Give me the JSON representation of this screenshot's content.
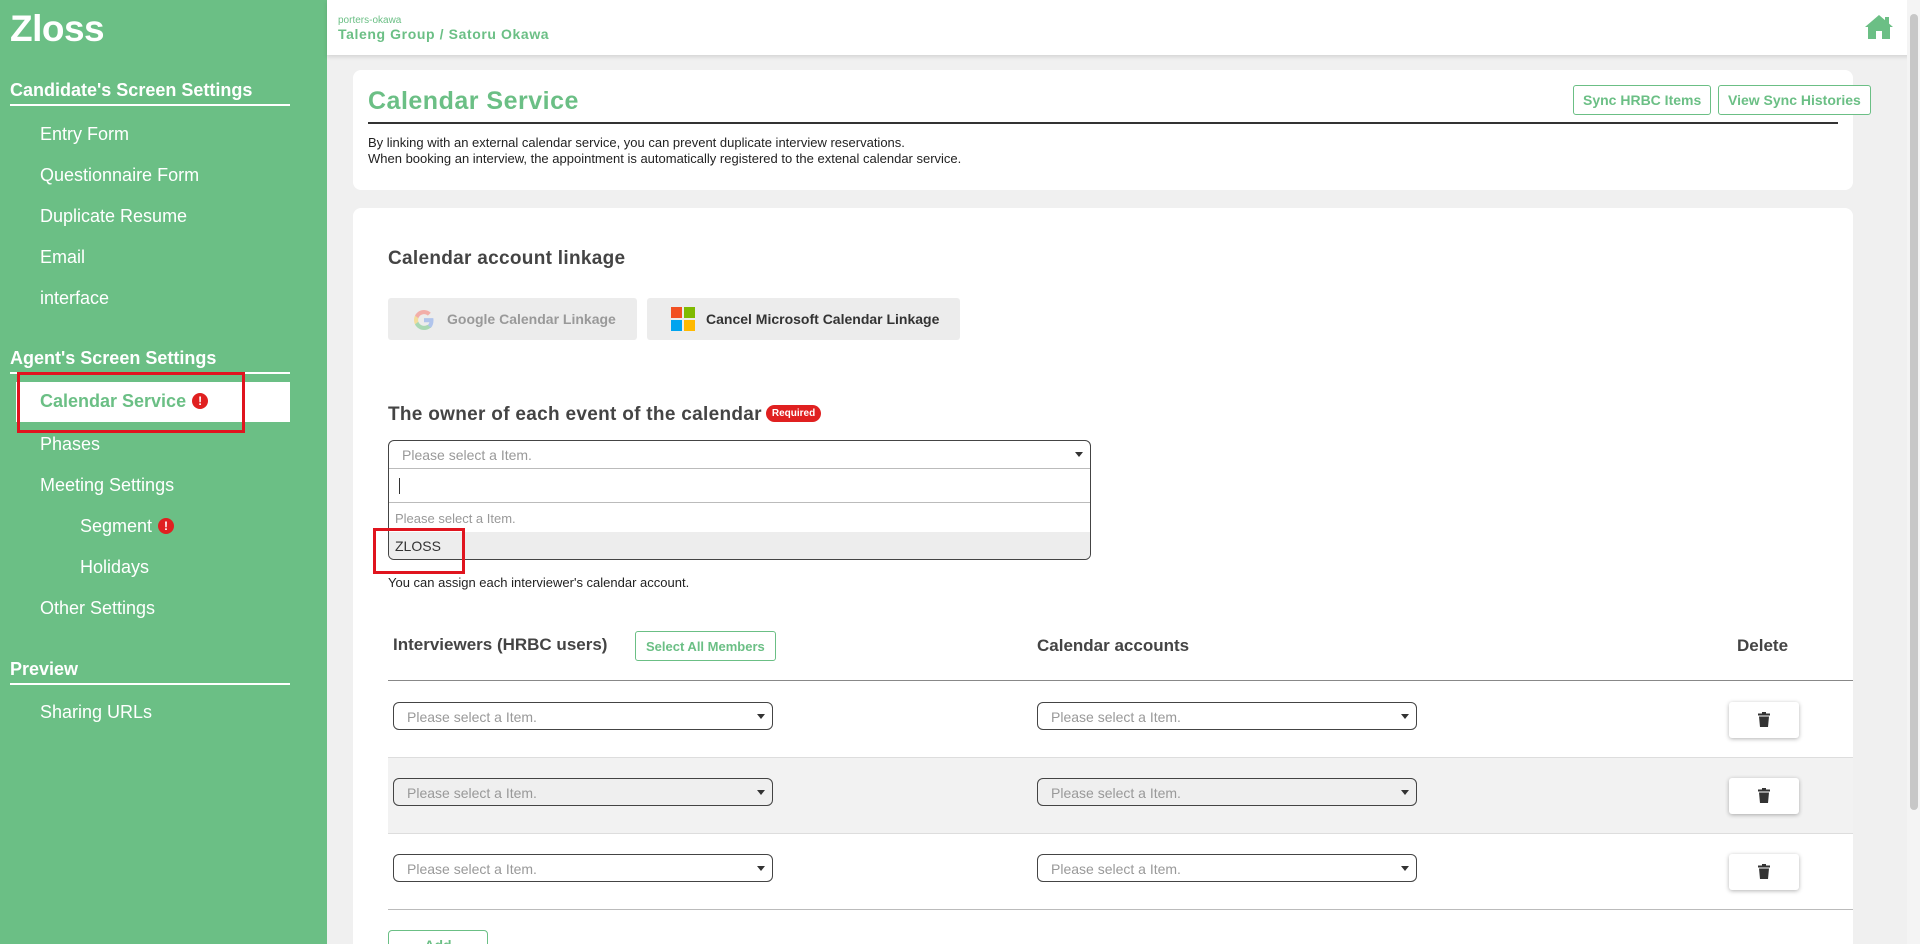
{
  "sidebar": {
    "brand": "Zloss",
    "sections": {
      "candidate": "Candidate's Screen Settings",
      "agent": "Agent's Screen Settings",
      "preview": "Preview"
    },
    "candidate_items": [
      "Entry Form",
      "Questionnaire Form",
      "Duplicate Resume",
      "Email",
      "interface"
    ],
    "agent_items": {
      "calendar_service": "Calendar Service",
      "phases": "Phases",
      "meeting_settings": "Meeting Settings",
      "segment": "Segment",
      "holidays": "Holidays",
      "other_settings": "Other Settings"
    },
    "preview_items": [
      "Sharing URLs"
    ],
    "alert_glyph": "!"
  },
  "header": {
    "tenant": "porters-okawa",
    "org_user": "Taleng Group / Satoru Okawa",
    "home_icon": "home-icon"
  },
  "page": {
    "title": "Calendar Service",
    "sync_button": "Sync HRBC Items",
    "histories_button": "View Sync Histories",
    "description": [
      "By linking with an external calendar service, you can prevent duplicate interview reservations.",
      "When booking an interview, the appointment is automatically registered to the extenal calendar service."
    ]
  },
  "linkage": {
    "heading": "Calendar account linkage",
    "google_button": "Google Calendar Linkage",
    "microsoft_button": "Cancel Microsoft Calendar Linkage"
  },
  "owner": {
    "heading": "The owner of each event of the calendar",
    "required_badge": "Required",
    "select_placeholder": "Please select a Item.",
    "options": [
      "Please select a Item.",
      "ZLOSS"
    ],
    "note": "You can assign each interviewer's calendar account."
  },
  "table": {
    "col_interviewers": "Interviewers (HRBC users)",
    "select_all": "Select All Members",
    "col_accounts": "Calendar accounts",
    "col_delete": "Delete",
    "rows": [
      {
        "interviewer": "Please select a Item.",
        "account": "Please select a Item."
      },
      {
        "interviewer": "Please select a Item.",
        "account": "Please select a Item."
      },
      {
        "interviewer": "Please select a Item.",
        "account": "Please select a Item."
      }
    ],
    "add_button": "Add"
  },
  "colors": {
    "brand_green": "#6bbf85",
    "alert_red": "#e02020",
    "highlight_red": "#e0141e"
  }
}
